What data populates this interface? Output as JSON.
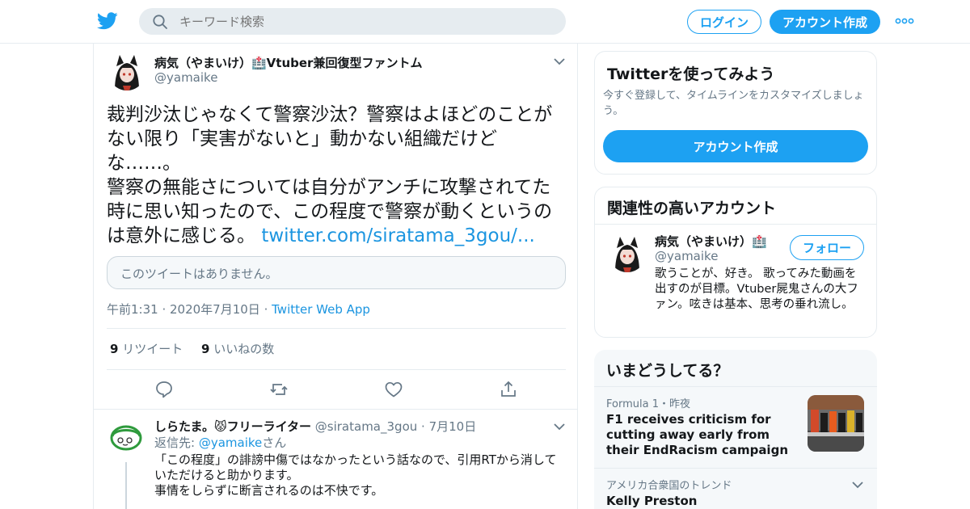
{
  "header": {
    "search_placeholder": "キーワード検索",
    "login_label": "ログイン",
    "signup_label": "アカウント作成"
  },
  "tweet": {
    "user_name": "病気（やまいけ）🏥Vtuber兼回復型ファントム",
    "handle": "@yamaike",
    "text": "裁判沙汰じゃなくて警察沙汰？警察はよほどのことがない限り「実害がないと」動かない組織だけどな……。\n警察の無能さについては自分がアンチに攻撃されてた時に思い知ったので、この程度で警察が動くというのは意外に感じる。 ",
    "link": "twitter.com/siratama_3gou/...",
    "quote_unavailable": "このツイートはありません。",
    "time": "午前1:31",
    "date": "2020年7月10日",
    "source": "Twitter Web App",
    "retweet_count": "9",
    "retweet_label": "リツイート",
    "like_count": "9",
    "like_label": "いいねの数"
  },
  "reply": {
    "user_name": "しらたま。😾フリーライター",
    "handle": "@siratama_3gou",
    "date": "7月10日",
    "reply_prefix": "返信先: ",
    "reply_handle": "@yamaike",
    "reply_suffix": "さん",
    "text": "「この程度」の誹謗中傷ではなかったという話なので、引用RTから消していただけると助かります。\n事情をしらずに断言されるのは不快です。"
  },
  "signup_card": {
    "title": "Twitterを使ってみよう",
    "desc": "今すぐ登録して、タイムラインをカスタマイズしましょう。",
    "button": "アカウント作成"
  },
  "related_card": {
    "title": "関連性の高いアカウント",
    "user_name": "病気（やまいけ）🏥",
    "handle": "@yamaike",
    "follow_label": "フォロー",
    "bio": "歌うことが、好き。 歌ってみた動画を出すのが目標。Vtuber屍鬼さんの大ファン。呟きは基本、思考の垂れ流し。"
  },
  "trends_card": {
    "title": "いまどうしてる？",
    "items": [
      {
        "meta": "Formula 1・昨夜",
        "title": "F1 receives criticism for cutting away early from their EndRacism campaign"
      },
      {
        "meta": "アメリカ合衆国のトレンド",
        "title": "Kelly Preston"
      }
    ]
  },
  "colors": {
    "accent": "#1da1f2",
    "link": "#1b95e0",
    "muted": "#657786"
  }
}
